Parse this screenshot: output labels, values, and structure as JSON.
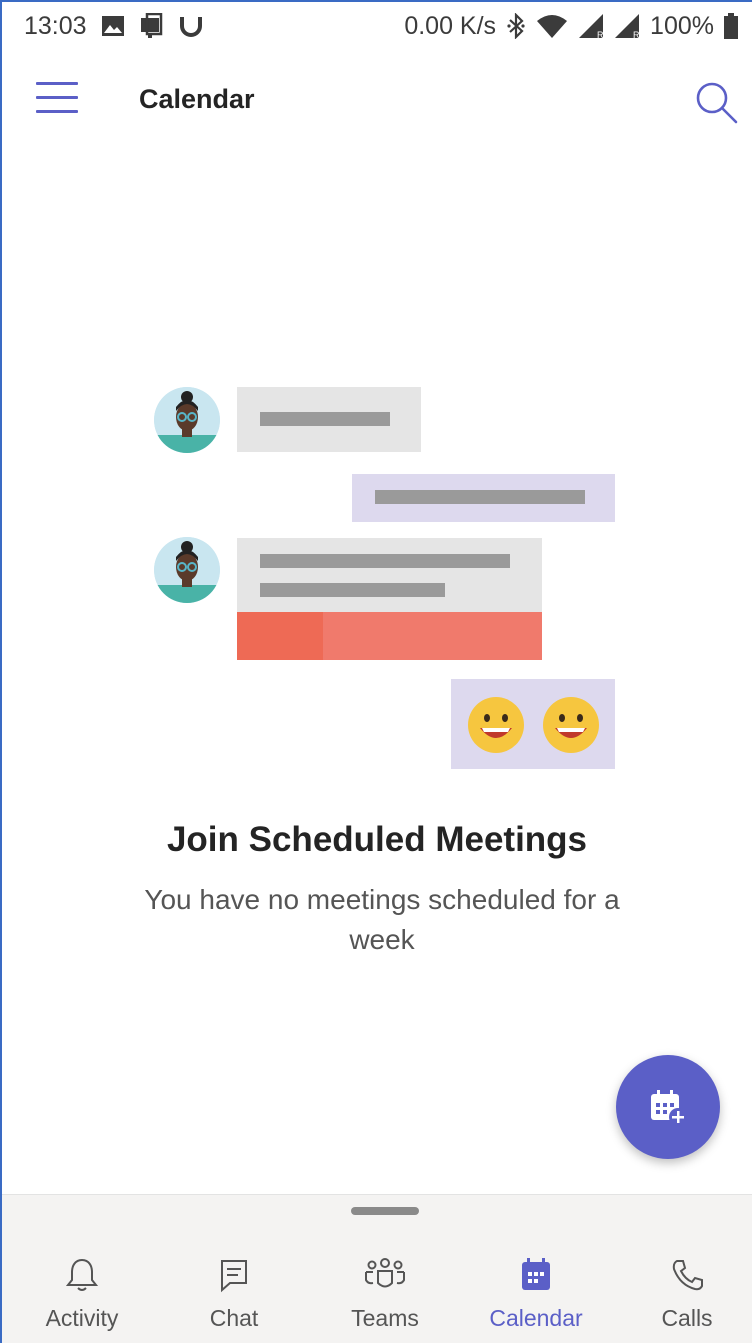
{
  "status_bar": {
    "time": "13:03",
    "net_speed": "0.00 K/s",
    "battery": "100%",
    "icons_left": [
      "image-icon",
      "nfc-icon",
      "magnet-icon"
    ],
    "icons_right": [
      "bluetooth-icon",
      "wifi-icon",
      "signal-icon",
      "signal-icon",
      "battery-icon"
    ]
  },
  "header": {
    "title": "Calendar"
  },
  "empty_state": {
    "title": "Join Scheduled Meetings",
    "subtitle": "You have no meetings scheduled for a week"
  },
  "fab": {
    "icon": "calendar-add-icon",
    "color": "#5b5fc7"
  },
  "nav": {
    "items": [
      {
        "label": "Activity",
        "icon": "bell-icon",
        "active": false
      },
      {
        "label": "Chat",
        "icon": "chat-icon",
        "active": false
      },
      {
        "label": "Teams",
        "icon": "teams-icon",
        "active": false
      },
      {
        "label": "Calendar",
        "icon": "calendar-icon",
        "active": true
      },
      {
        "label": "Calls",
        "icon": "phone-icon",
        "active": false
      }
    ]
  },
  "colors": {
    "accent": "#5b5fc7",
    "bubble_grey": "#e5e5e5",
    "bubble_purple": "#ddd9ee",
    "bubble_red": "#f07a6c",
    "emoji_yellow": "#f6c63f"
  }
}
